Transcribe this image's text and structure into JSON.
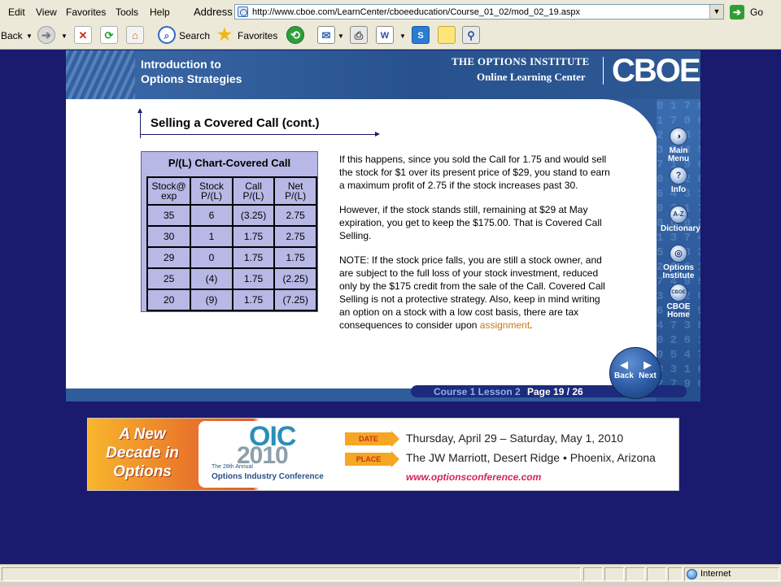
{
  "browser": {
    "menu": [
      "Edit",
      "View",
      "Favorites",
      "Tools",
      "Help"
    ],
    "address_label": "Address",
    "url": "http://www.cboe.com/LearnCenter/cboeeducation/Course_01_02/mod_02_19.aspx",
    "go_label": "Go",
    "toolbar": {
      "back_label": "Back",
      "search_label": "Search",
      "favorites_label": "Favorites"
    },
    "status": {
      "zone_label": "Internet"
    }
  },
  "header": {
    "course_title_line1": "Introduction to",
    "course_title_line2": "Options Strategies",
    "institute_name": "THE OPTIONS INSTITUTE",
    "institute_subtitle": "Online Learning Center",
    "logo_text": "CBOE"
  },
  "nav": {
    "items": [
      {
        "label": "Main Menu",
        "icon": "main-menu-icon",
        "glyph": "◑"
      },
      {
        "label": "Info",
        "icon": "info-icon",
        "glyph": "?"
      },
      {
        "label": "Dictionary",
        "icon": "dictionary-icon",
        "glyph": "A-Z"
      },
      {
        "label": "Options Institute",
        "icon": "options-institute-icon",
        "glyph": "◎"
      },
      {
        "label": "CBOE Home",
        "icon": "cboe-home-icon",
        "glyph": "CBOE"
      }
    ],
    "back_label": "Back",
    "next_label": "Next"
  },
  "section_title": "Selling a Covered Call (cont.)",
  "pl_table": {
    "title": "P/(L) Chart-Covered Call",
    "headers": [
      [
        "Stock@",
        "exp"
      ],
      [
        "Stock",
        "P/(L)"
      ],
      [
        "Call",
        "P/(L)"
      ],
      [
        "Net",
        "P/(L)"
      ]
    ],
    "rows": [
      [
        "35",
        "6",
        "(3.25)",
        "2.75"
      ],
      [
        "30",
        "1",
        "1.75",
        "2.75"
      ],
      [
        "29",
        "0",
        "1.75",
        "1.75"
      ],
      [
        "25",
        "(4)",
        "1.75",
        "(2.25)"
      ],
      [
        "20",
        "(9)",
        "1.75",
        "(7.25)"
      ]
    ]
  },
  "body": {
    "p1": "If this happens, since you sold the Call for 1.75 and would sell the stock for $1 over its present price of $29, you stand to earn a maximum profit of 2.75 if the stock increases past 30.",
    "p2": "However, if the stock stands still, remaining at $29 at May expiration, you get to keep the $175.00. That is Covered Call Selling.",
    "p3": "NOTE: If the stock price falls, you are still a stock owner, and are subject to the full loss of your stock investment, reduced only by the $175 credit from the sale of the Call. Covered Call Selling is not a protective strategy. Also, keep in mind writing an option on a stock with a low cost basis, there are tax consequences to consider upon",
    "link": "assignment",
    "p3_end": "."
  },
  "page_bar": {
    "lesson": "Course 1 Lesson 2",
    "page": "Page 19 / 26"
  },
  "banner": {
    "tagline": "A New Decade in Options",
    "logo_top": "OIC",
    "logo_year": "2010",
    "annual": "The 28th Annual",
    "conference": "Options Industry Conference",
    "date_tag": "DATE",
    "place_tag": "PLACE",
    "date": "Thursday, April 29 – Saturday, May 1, 2010",
    "place": "The JW Marriott, Desert Ridge • Phoenix, Arizona",
    "url": "www.optionsconference.com"
  },
  "colors": {
    "page_background": "#1a1a6e",
    "brand_blue": "#2f5c9a",
    "table_fill": "#b8b8e6",
    "link": "#c57a14"
  }
}
